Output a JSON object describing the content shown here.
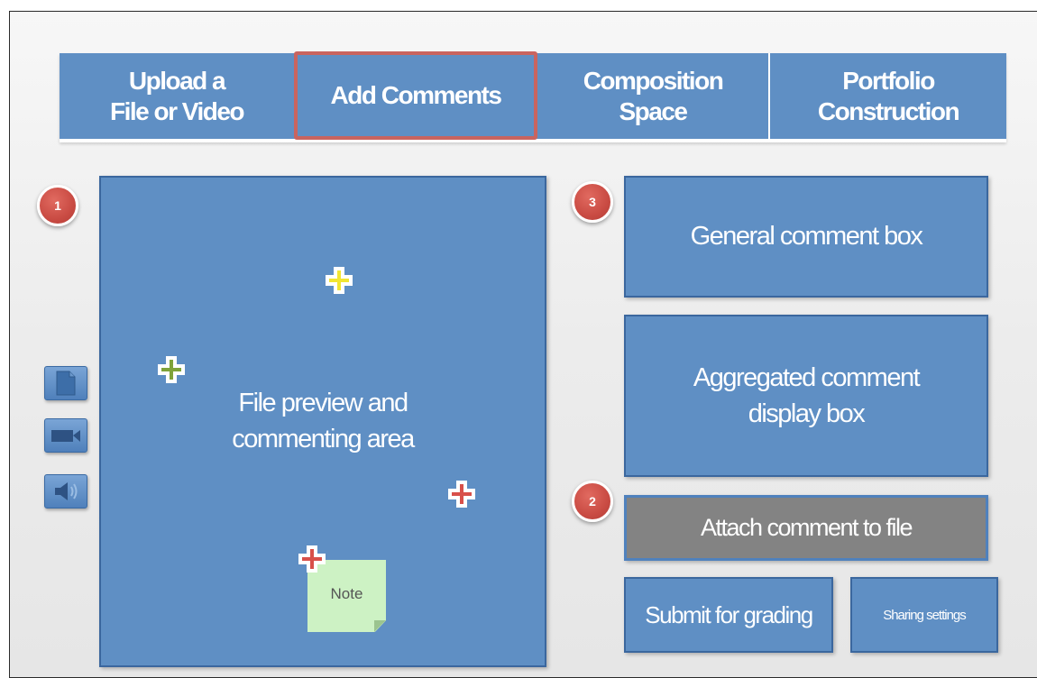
{
  "tabs": {
    "upload": "Upload  a\nFile or Video",
    "add_comments": "Add Comments",
    "composition": "Composition\nSpace",
    "portfolio": "Portfolio\nConstruction"
  },
  "badges": {
    "one": "1",
    "two": "2",
    "three": "3"
  },
  "preview": {
    "label": "File preview and\ncommenting area",
    "note": "Note"
  },
  "boxes": {
    "general": "General comment box",
    "aggregated": "Aggregated comment\ndisplay box",
    "attach": "Attach comment to file",
    "submit": "Submit for grading",
    "sharing": "Sharing settings"
  },
  "side_icons": [
    "document-icon",
    "video-camera-icon",
    "speaker-icon"
  ],
  "colors": {
    "panel_blue": "#5f8fc4",
    "active_border": "#c9645f",
    "badge_red": "#c94b43",
    "attach_gray": "#838383",
    "note_green": "#cdf2c4",
    "plus_yellow": "#f2e632",
    "plus_green": "#7fa33a",
    "plus_red": "#d8504a"
  }
}
